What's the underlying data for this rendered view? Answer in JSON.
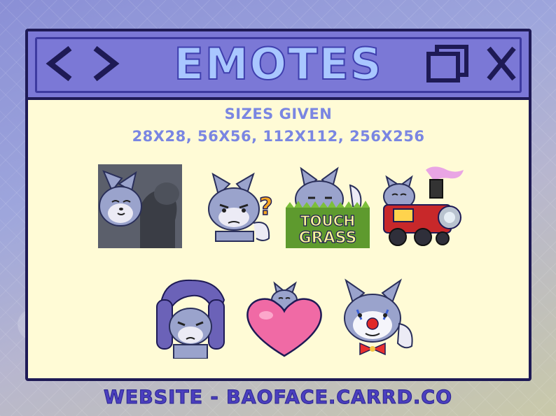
{
  "window": {
    "title": "EMOTES",
    "back_icon": "chevron-left-icon",
    "forward_icon": "chevron-right-icon",
    "restore_icon": "restore-windows-icon",
    "close_icon": "close-icon"
  },
  "content": {
    "sizes_heading": "SIZES GIVEN",
    "sizes_values": "28X28, 56X56, 112X112, 256X256",
    "emotes": [
      {
        "name": "wolf-flex-emote"
      },
      {
        "name": "wolf-confused-emote"
      },
      {
        "name": "wolf-touch-grass-emote",
        "text_line1": "TOUCH",
        "text_line2": "GRASS"
      },
      {
        "name": "wolf-train-emote"
      },
      {
        "name": "wolf-facepalm-emote"
      },
      {
        "name": "wolf-heart-emote"
      },
      {
        "name": "wolf-clown-emote"
      }
    ]
  },
  "footer": {
    "text": "WEBSITE - BAOFACE.CARRD.CO"
  },
  "colors": {
    "titlebar": "#7b78d6",
    "border": "#1e1a55",
    "panel": "#fffbd6",
    "title_text": "#a9c7ff",
    "size_text": "#7a86e2",
    "footer_text": "#4b3fbf"
  }
}
